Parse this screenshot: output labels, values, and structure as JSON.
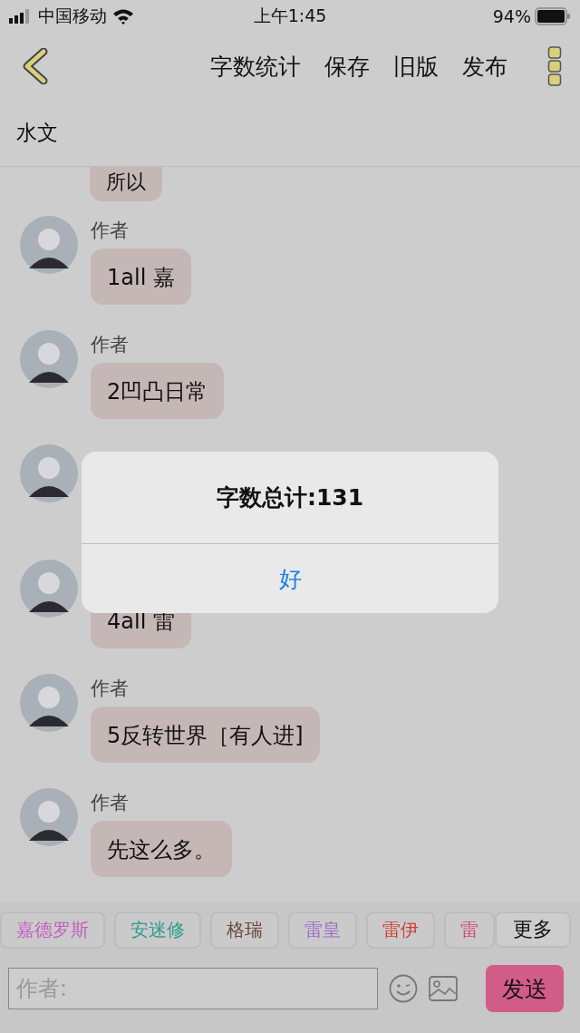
{
  "status_bar": {
    "carrier": "中国移动",
    "time": "上午1:45",
    "battery": "94%"
  },
  "nav": {
    "actions": [
      "字数统计",
      "保存",
      "旧版",
      "发布"
    ]
  },
  "chat_title": "水文",
  "messages": [
    {
      "kind": "partial",
      "text": "所以"
    },
    {
      "kind": "full",
      "author": "作者",
      "text": "1all 嘉"
    },
    {
      "kind": "full",
      "author": "作者",
      "text": "2凹凸日常"
    },
    {
      "kind": "covered"
    },
    {
      "kind": "bubble_only",
      "text": "4all 雷"
    },
    {
      "kind": "full",
      "author": "作者",
      "text": "5反转世界［有人进]"
    },
    {
      "kind": "full",
      "author": "作者",
      "text": "先这么多。"
    }
  ],
  "alert": {
    "message": "字数总计:131",
    "button": "好"
  },
  "tags": [
    {
      "label": "嘉德罗斯",
      "color": "#c45cc4"
    },
    {
      "label": "安迷修",
      "color": "#2e9c8c"
    },
    {
      "label": "格瑞",
      "color": "#6a4a3c"
    },
    {
      "label": "雷皇",
      "color": "#9a6cc6"
    },
    {
      "label": "雷伊",
      "color": "#d03c34"
    },
    {
      "label": "雷",
      "color": "#d04a70"
    }
  ],
  "more_button": "更多",
  "input": {
    "placeholder": "作者:"
  },
  "send_button": "发送"
}
